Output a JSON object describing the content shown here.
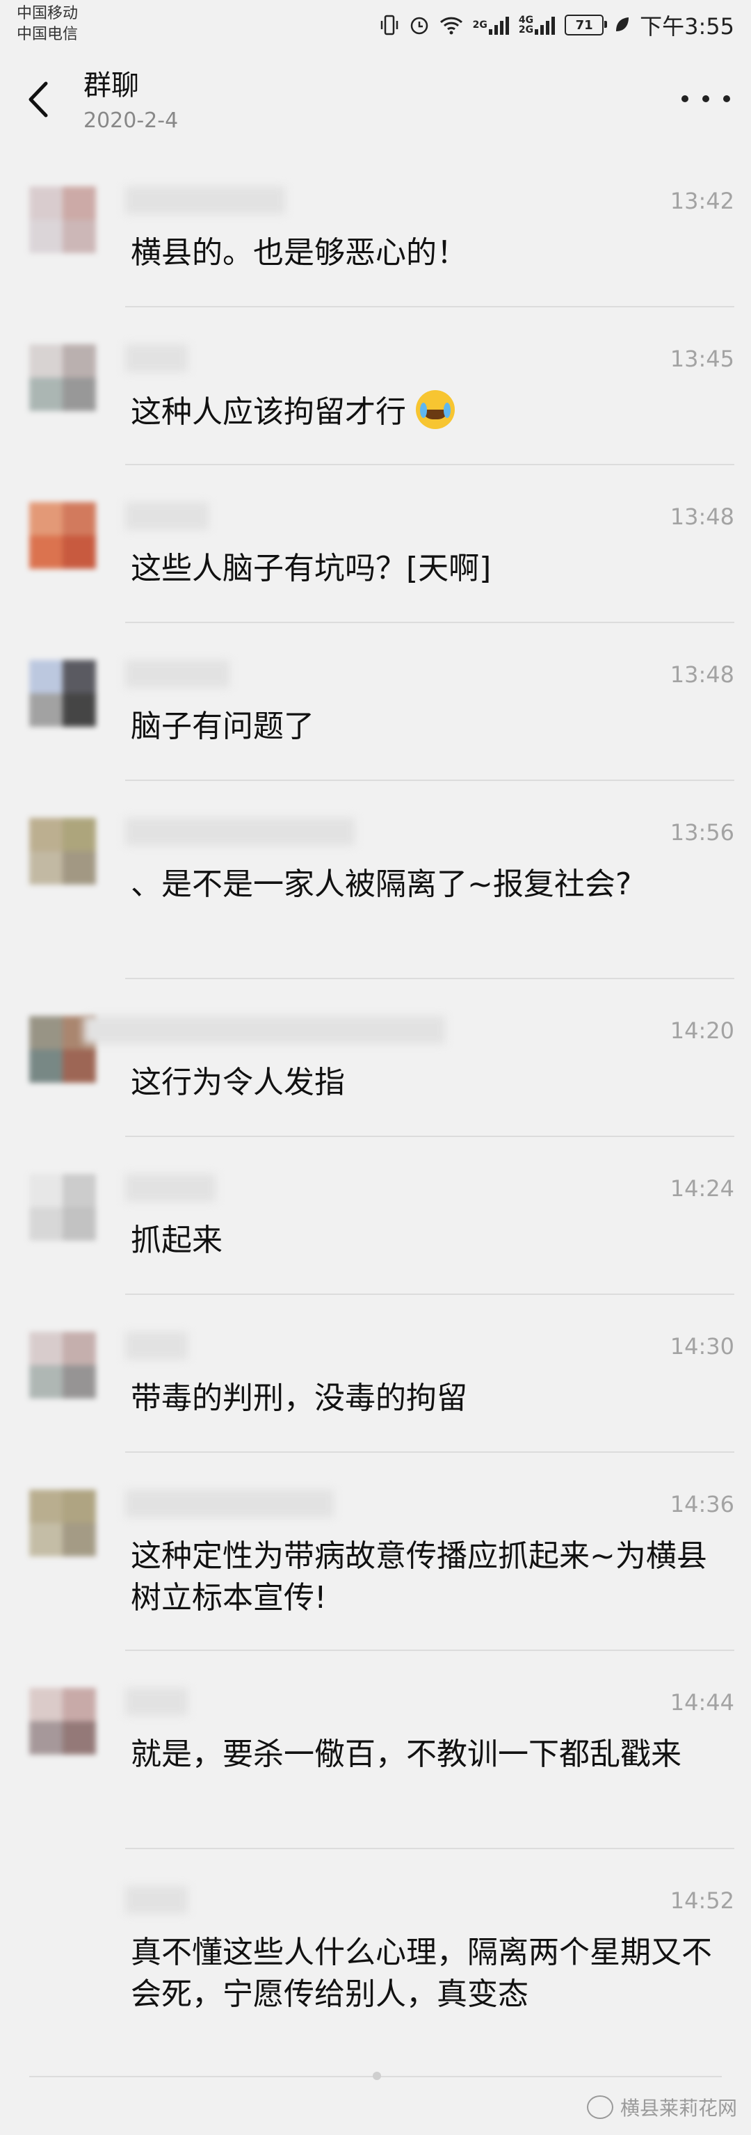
{
  "status_bar": {
    "carrier1": "中国移动",
    "carrier2": "中国电信",
    "net1": "2G",
    "net2_top": "4G",
    "net2_bottom": "2G",
    "battery": "71",
    "time": "下午3:55"
  },
  "header": {
    "title": "群聊",
    "subtitle": "2020-2-4"
  },
  "messages": [
    {
      "time": "13:42",
      "text": "横县的。也是够恶心的！"
    },
    {
      "time": "13:45",
      "text": "这种人应该拘留才行"
    },
    {
      "time": "13:48",
      "text": "这些人脑子有坑吗？[天啊]"
    },
    {
      "time": "13:48",
      "text": "脑子有问题了"
    },
    {
      "time": "13:56",
      "text": "、是不是一家人被隔离了~报复社会?"
    },
    {
      "time": "14:20",
      "text": "这行为令人发指"
    },
    {
      "time": "14:24",
      "text": "抓起来"
    },
    {
      "time": "14:30",
      "text": "带毒的判刑，没毒的拘留"
    },
    {
      "time": "14:36",
      "text": "这种定性为带病故意传播应抓起来~为横县树立标本宣传!"
    },
    {
      "time": "14:44",
      "text": "就是，要杀一儆百，不教训一下都乱戳来"
    },
    {
      "time": "14:52",
      "text": "真不懂这些人什么心理，隔离两个星期又不会死，宁愿传给别人，真变态"
    }
  ],
  "watermark": "横县莱莉花网",
  "colors": {
    "background": "#f1f1f1",
    "timestamp": "#a3a3a3",
    "divider": "#dcdcdc"
  }
}
